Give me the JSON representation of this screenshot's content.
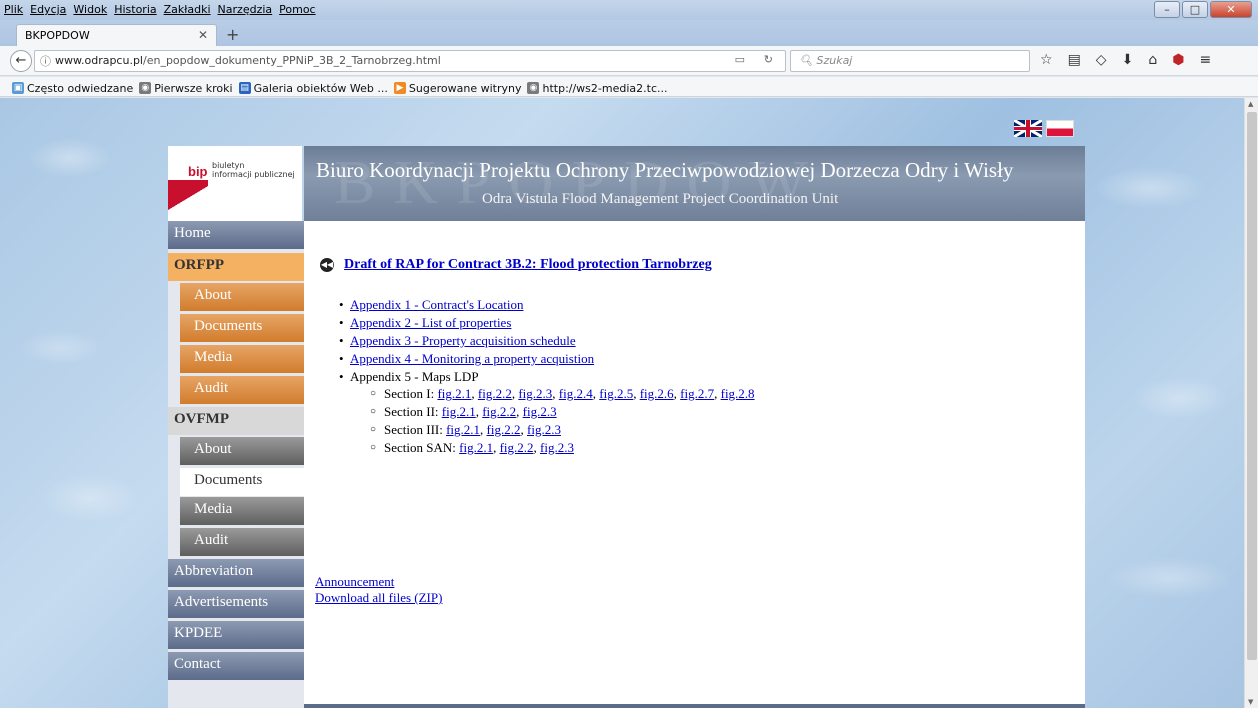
{
  "browser": {
    "menu": [
      "Plik",
      "Edycja",
      "Widok",
      "Historia",
      "Zakładki",
      "Narzędzia",
      "Pomoc"
    ],
    "tab_title": "BKPOPDOW",
    "url_host": "www.odrapcu.pl",
    "url_path": "/en_popdow_dokumenty_PPNiP_3B_2_Tarnobrzeg.html",
    "search_placeholder": "Szukaj",
    "bookmarks": [
      "Często odwiedzane",
      "Pierwsze kroki",
      "Galeria obiektów Web ...",
      "Sugerowane witryny",
      "http://ws2-media2.tc..."
    ]
  },
  "header": {
    "bip_line1": "biuletyn",
    "bip_line2": "informacji publicznej",
    "bip_logo": "bip",
    "title": "Biuro Koordynacji Projektu Ochrony Przeciwpowodziowej Dorzecza Odry i Wisły",
    "subtitle": "Odra Vistula Flood Management Project Coordination Unit",
    "watermark": "BKPOPDOW"
  },
  "sidebar": {
    "home": "Home",
    "orfpp": "ORFPP",
    "orfpp_items": [
      "About",
      "Documents",
      "Media",
      "Audit"
    ],
    "ovfmp": "OVFMP",
    "ovfmp_items": [
      "About",
      "Documents",
      "Media",
      "Audit"
    ],
    "abbreviation": "Abbreviation",
    "advertisements": "Advertisements",
    "kpdee": "KPDEE",
    "contact": "Contact"
  },
  "content": {
    "title": "Draft of RAP for Contract 3B.2: Flood protection Tarnobrzeg",
    "appendices": [
      "Appendix 1 - Contract's Location",
      "Appendix 2 - List of properties",
      "Appendix 3 - Property acquisition schedule",
      "Appendix 4 - Monitoring a property acquistion"
    ],
    "appendix5": "Appendix 5 - Maps LDP",
    "sections": [
      {
        "label": "Section I:",
        "figs": [
          "fig.2.1",
          "fig.2.2",
          "fig.2.3",
          "fig.2.4",
          "fig.2.5",
          "fig.2.6",
          "fig.2.7",
          "fig.2.8"
        ]
      },
      {
        "label": "Section II:",
        "figs": [
          "fig.2.1",
          "fig.2.2",
          "fig.2.3"
        ]
      },
      {
        "label": "Section III:",
        "figs": [
          "fig.2.1",
          "fig.2.2",
          "fig.2.3"
        ]
      },
      {
        "label": "Section SAN:",
        "figs": [
          "fig.2.1",
          "fig.2.2",
          "fig.2.3"
        ]
      }
    ],
    "announcement": "Announcement",
    "download": "Download all files (ZIP)"
  },
  "colors": {
    "sidebar_blue": "#5b6b8a",
    "sidebar_orange": "#d17c2c",
    "sidebar_grey": "#5f5f5f",
    "link": "#0000cc"
  }
}
